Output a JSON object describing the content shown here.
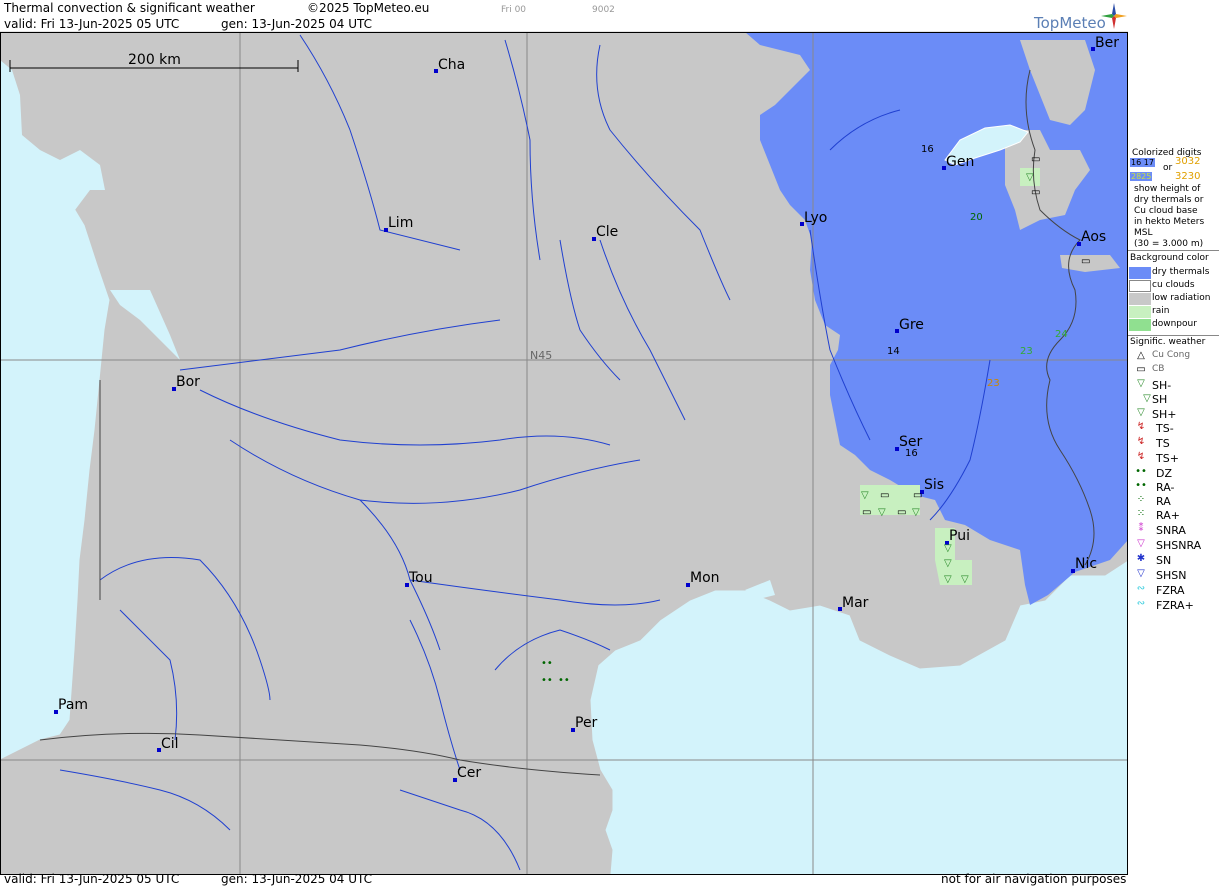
{
  "header": {
    "title": "Thermal convection & significant weather",
    "copyright": "©2025 TopMeteo.eu",
    "frame_day": "Fri 00",
    "frame_code": "9002",
    "valid_line": "valid:  Fri  13-Jun-2025  05 UTC",
    "gen_line": "gen: 13-Jun-2025 04 UTC",
    "logo": "TopMeteo"
  },
  "map": {
    "scale_label": "200 km",
    "latitude_label": "N45",
    "colors": {
      "sea": "#d3f3fb",
      "low_radiation": "#c8c8c8",
      "dry_thermals": "#6b8cf7",
      "rain": "#c8f0c0",
      "river": "#2040d0",
      "grid": "#888888",
      "city": "#0000cc"
    },
    "cities": [
      {
        "name": "Cha"
      },
      {
        "name": "Ber"
      },
      {
        "name": "Gen"
      },
      {
        "name": "Lim"
      },
      {
        "name": "Cle"
      },
      {
        "name": "Lyo"
      },
      {
        "name": "Aos"
      },
      {
        "name": "Gre"
      },
      {
        "name": "Bor"
      },
      {
        "name": "Ser"
      },
      {
        "name": "Sis"
      },
      {
        "name": "Pui"
      },
      {
        "name": "Tou"
      },
      {
        "name": "Mon"
      },
      {
        "name": "Nic"
      },
      {
        "name": "Mar"
      },
      {
        "name": "Pam"
      },
      {
        "name": "Per"
      },
      {
        "name": "Cil"
      },
      {
        "name": "Cer"
      }
    ],
    "digits": [
      "16",
      "20",
      "14",
      "16",
      "24",
      "23",
      "23"
    ]
  },
  "legend": {
    "colorized_title": "Colorized digits",
    "sample1": "16 17",
    "or": "or",
    "sample2": "3032",
    "sample3": "2825",
    "sample4": "3230",
    "desc1": "show height of",
    "desc2": "dry thermals or",
    "desc3": "Cu cloud base",
    "desc4": "in hekto Meters",
    "desc5": "MSL",
    "desc6": "(30 = 3.000 m)",
    "bg_title": "Background color",
    "bg_items": [
      "dry thermals",
      "cu clouds",
      "low radiation",
      "rain",
      "downpour"
    ],
    "bg_colors": [
      "#6b8cf7",
      "#ffffff",
      "#c8c8c8",
      "#c8f0c0",
      "#90e090"
    ],
    "sig_title": "Signific. weather",
    "sig_items": [
      "Cu Cong",
      "CB",
      "SH-",
      "SH",
      "SH+",
      "TS-",
      "TS",
      "TS+",
      "DZ",
      "RA-",
      "RA",
      "RA+",
      "SNRA",
      "SHSNRA",
      "SN",
      "SHSN",
      "FZRA",
      "FZRA+"
    ]
  },
  "footer": {
    "valid_line": "valid:  Fri  13-Jun-2025  05 UTC",
    "gen_line": "gen: 13-Jun-2025 04 UTC",
    "note": "not for air navigation purposes"
  }
}
